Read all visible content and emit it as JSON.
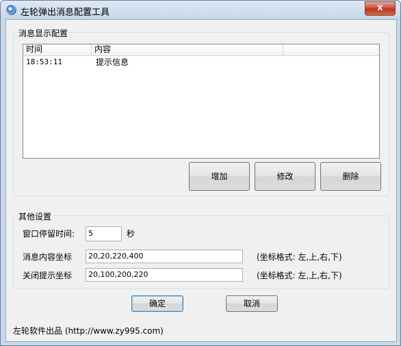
{
  "window": {
    "title": "左轮弹出消息配置工具",
    "close_glyph": "x"
  },
  "message_group": {
    "legend": "消息显示配置",
    "columns": [
      "时间",
      "内容",
      ""
    ],
    "rows": [
      {
        "time": "18:53:11",
        "content": "提示信息"
      }
    ],
    "add_label": "增加",
    "edit_label": "修改",
    "delete_label": "删除"
  },
  "other_group": {
    "legend": "其他设置",
    "stay_time_label": "窗口停留时间:",
    "stay_time_value": "5",
    "stay_time_unit": "秒",
    "content_coord_label": "消息内容坐标",
    "content_coord_value": "20,20,220,400",
    "content_coord_hint": "(坐标格式: 左,上,右,下)",
    "close_coord_label": "关闭提示坐标",
    "close_coord_value": "20,100,200,220",
    "close_coord_hint": "(坐标格式: 左,上,右,下)"
  },
  "footer": {
    "ok_label": "确定",
    "cancel_label": "取消",
    "credit": "左轮软件出品 (http://www.zy995.com)"
  }
}
